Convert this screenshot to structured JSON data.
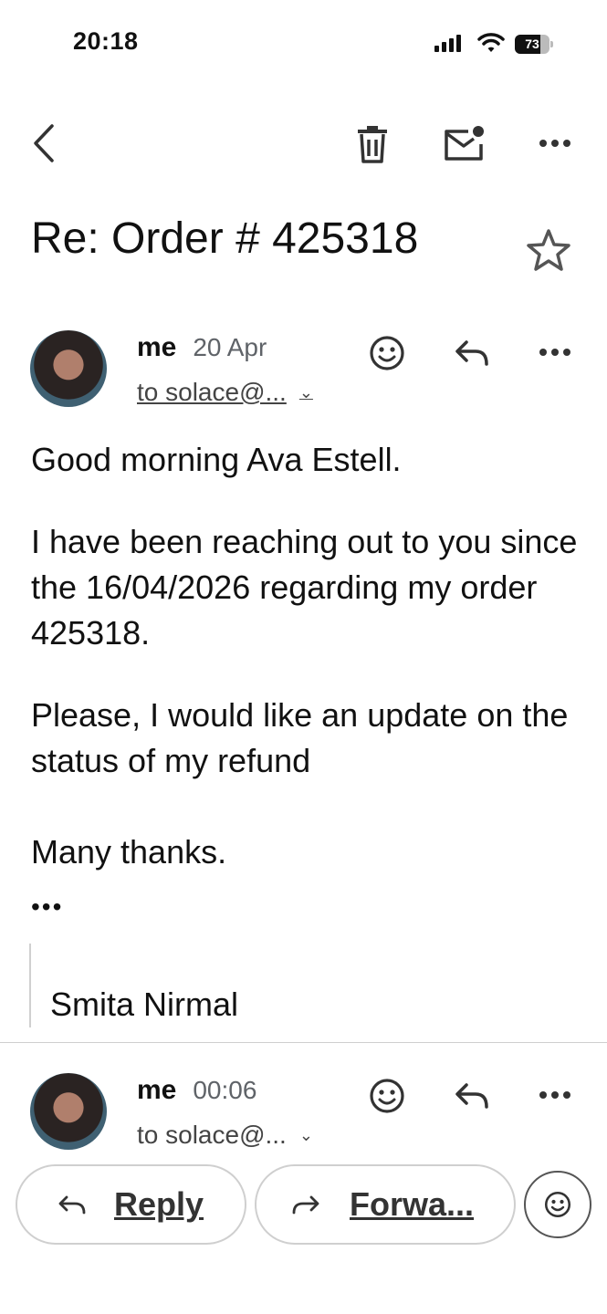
{
  "status_bar": {
    "time": "20:18",
    "battery": "73",
    "battery_level": 0.73
  },
  "email": {
    "subject": "Re: Order # 425318",
    "messages": [
      {
        "sender": "me",
        "date": "20 Apr",
        "to": "to solace@...",
        "body": [
          "Good morning Ava Estell.",
          "I have been reaching out to you since the 16/04/2026 regarding my order 425318.",
          "Please, I would like an update on the status of my refund",
          "Many thanks."
        ],
        "trimmed": "•••",
        "signature": "Smita Nirmal"
      },
      {
        "sender": "me",
        "date": "00:06",
        "to": "to solace@..."
      }
    ]
  },
  "actions": {
    "reply_label": "Reply",
    "forward_label": "Forwa..."
  },
  "icons": [
    "back-icon",
    "delete-icon",
    "mark-unread-icon",
    "more-icon",
    "star-icon",
    "emoji-react-icon",
    "reply-icon",
    "forward-icon",
    "chevron-down-icon"
  ]
}
